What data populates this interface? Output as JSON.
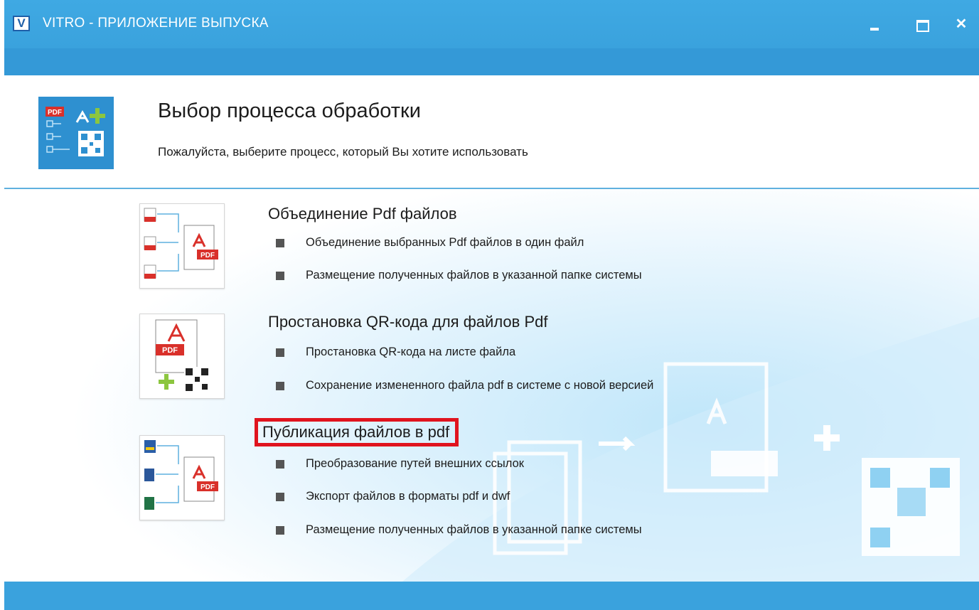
{
  "window": {
    "title": "VITRO - ПРИЛОЖЕНИЕ ВЫПУСКА",
    "logo_letter": "V",
    "buttons": {
      "minimize": "minimize",
      "maximize": "maximize",
      "close": "✕"
    }
  },
  "header": {
    "title": "Выбор процесса обработки",
    "subtitle": "Пожалуйста, выберите процесс, который Вы хотите использовать",
    "icon": "pdf-qr-process-icon"
  },
  "processes": [
    {
      "title": "Объединение Pdf файлов",
      "icon": "merge-pdf-icon",
      "bullets": [
        "Объединение выбранных Pdf файлов в один файл",
        "Размещение полученных файлов в указанной папке системы"
      ]
    },
    {
      "title": "Простановка QR-кода для файлов Pdf",
      "icon": "pdf-qr-code-icon",
      "bullets": [
        "Простановка QR-кода на листе файла",
        "Сохранение измененного файла pdf в системе с новой версией"
      ]
    },
    {
      "title": "Публикация файлов в pdf",
      "icon": "publish-to-pdf-icon",
      "selected": true,
      "bullets": [
        "Преобразование путей внешних ссылок",
        "Экспорт файлов в форматы pdf и dwf",
        "Размещение полученных файлов в указанной папке системы"
      ]
    }
  ],
  "labels": {
    "pdf_badge": "PDF"
  },
  "colors": {
    "titlebar": "#3fa9e3",
    "ribbon": "#3499d7",
    "selection": "#e0141e",
    "pdf_red": "#d9302a",
    "plus_green": "#8cc63f"
  }
}
